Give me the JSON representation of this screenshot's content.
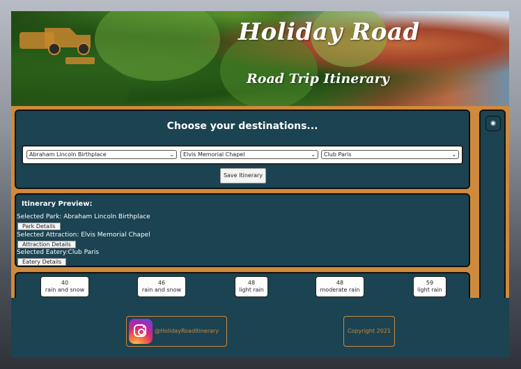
{
  "header": {
    "logo_text": "HOLIDAY ROAD",
    "title": "Holiday Road",
    "subtitle": "Road Trip Itinerary"
  },
  "chooser": {
    "heading": "Choose your destinations...",
    "park_select": "Abraham Lincoln Birthplace",
    "attraction_select": "Elvis Memorial Chapel",
    "eatery_select": "Club Paris",
    "save_label": "Save Itinerary"
  },
  "sidebar": {
    "button_icon": "circle-icon"
  },
  "preview": {
    "heading": "Itinerary Preview:",
    "park_line": "Selected Park: Abraham Lincoln Birthplace",
    "park_btn": "Park Details",
    "attraction_line": "Selected Attraction: Elvis Memorial Chapel",
    "attraction_btn": "Attraction Details",
    "eatery_line": "Selected Eatery:Club Paris",
    "eatery_btn": "Eatery Details"
  },
  "weather": [
    {
      "temp": "40",
      "desc": "rain and snow"
    },
    {
      "temp": "46",
      "desc": "rain and snow"
    },
    {
      "temp": "48",
      "desc": "light rain"
    },
    {
      "temp": "48",
      "desc": "moderate rain"
    },
    {
      "temp": "59",
      "desc": "light rain"
    }
  ],
  "footer": {
    "instagram_handle": "@HolidayRoadItinerary",
    "copyright": "Copyright 2021"
  },
  "colors": {
    "accent": "#cf8a3c",
    "panel": "#1b4352"
  }
}
